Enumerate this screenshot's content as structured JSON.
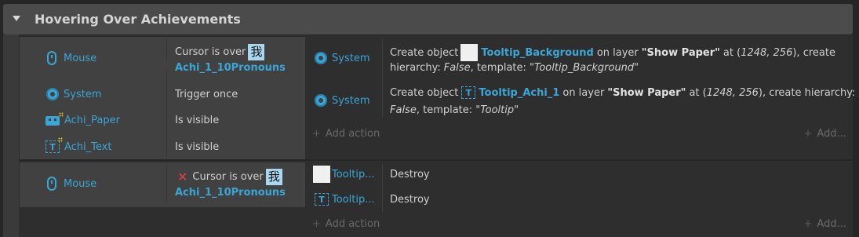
{
  "group": {
    "title": "Hovering Over Achievements"
  },
  "event1": {
    "conditions": [
      {
        "object": "Mouse",
        "text_prefix": "Cursor is over",
        "kanji": "我",
        "target": "Achi_1_10Pronouns"
      },
      {
        "object": "System",
        "text": "Trigger once"
      },
      {
        "object": "Achi_Paper",
        "text": "Is visible"
      },
      {
        "object": "Achi_Text",
        "text": "Is visible"
      }
    ],
    "actions": [
      {
        "object": "System",
        "line1_prefix": "Create object",
        "target": "Tooltip_Background",
        "on_layer": "on layer",
        "layer": "\"Show Paper\"",
        "at": "at (",
        "coords": "1248, 256",
        "after_coords": "), create",
        "line2_prefix": "hierarchy:",
        "hierarchy": "False",
        "template_label": ", template: \"",
        "template": "Tooltip_Background",
        "end_quote": "\""
      },
      {
        "object": "System",
        "line1_prefix": "Create object",
        "target": "Tooltip_Achi_1",
        "on_layer": "on layer",
        "layer": "\"Show Paper\"",
        "at": "at (",
        "coords": "1248, 256",
        "after_coords": "), create hierarchy:",
        "hierarchy": "False",
        "template_label": ", template: \"",
        "template": "Tooltip",
        "end_quote": "\""
      }
    ],
    "add_action": "Add action",
    "add_more": "Add..."
  },
  "event2": {
    "condition": {
      "object": "Mouse",
      "text_prefix": "Cursor is over",
      "kanji": "我",
      "target": "Achi_1_10Pronouns"
    },
    "actions": [
      {
        "object": "Tooltip...",
        "text": "Destroy"
      },
      {
        "object": "Tooltip...",
        "text": "Destroy"
      }
    ],
    "add_action": "Add action",
    "add_more": "Add..."
  },
  "colors": {
    "accent": "#3aa6d6",
    "invert": "#e04040",
    "kanji_bg": "#aad7f0"
  }
}
